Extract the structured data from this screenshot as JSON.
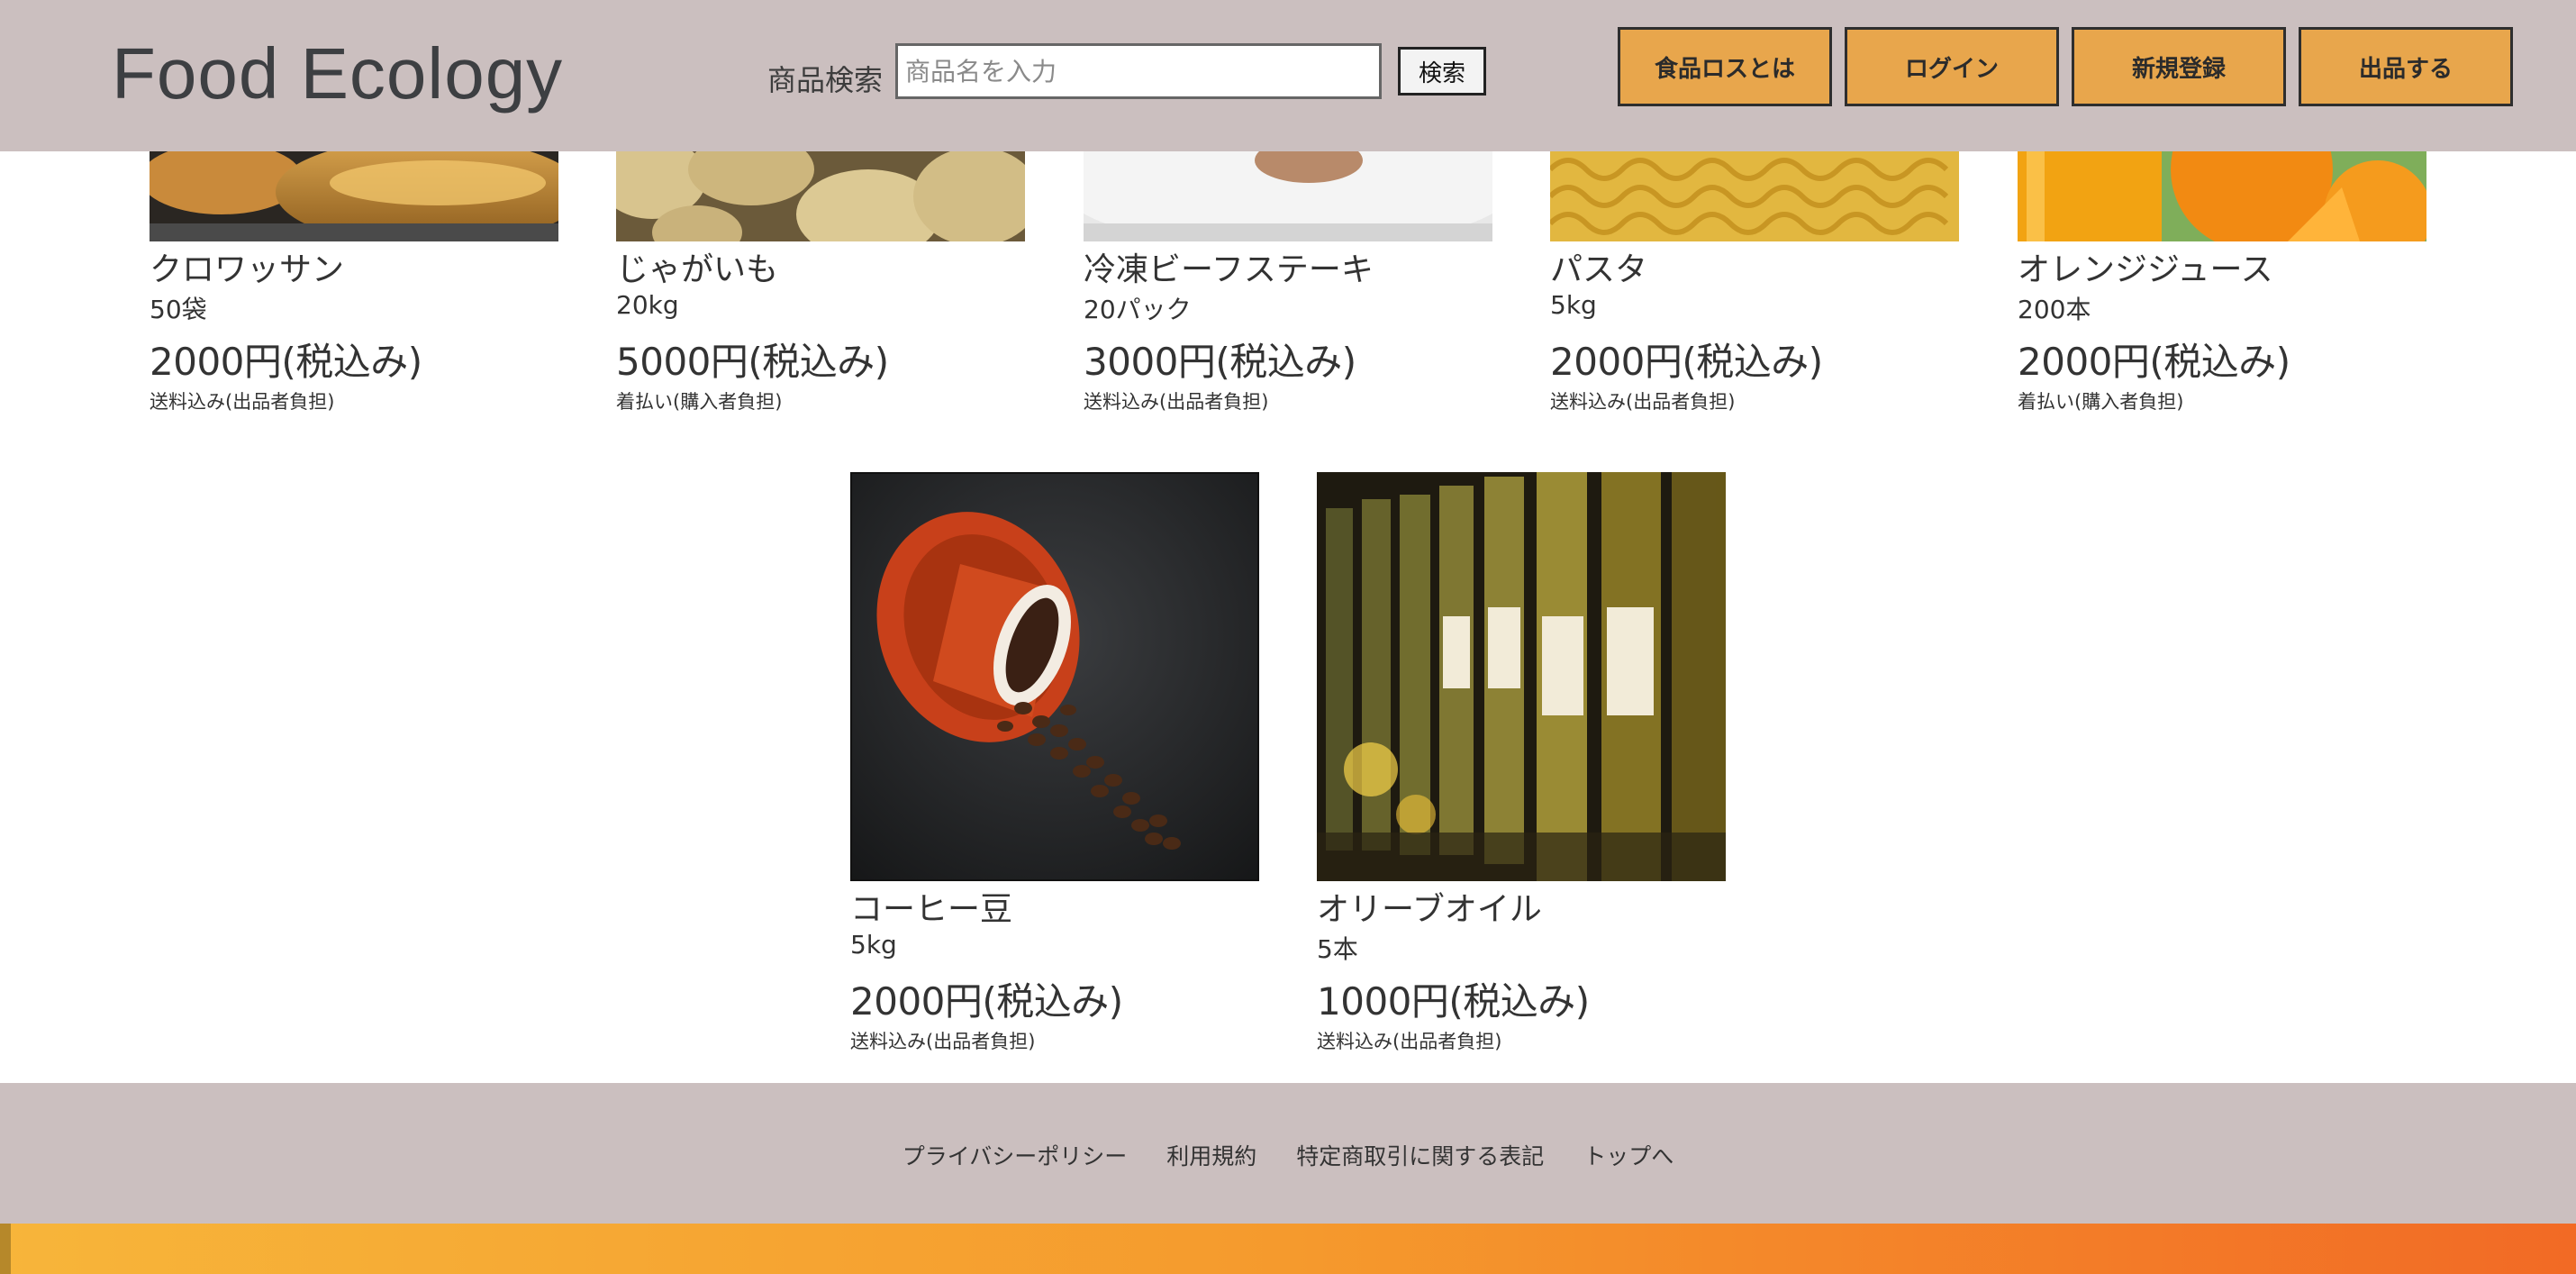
{
  "header": {
    "logo": "Food Ecology",
    "search_label": "商品検索",
    "search_placeholder": "商品名を入力",
    "search_button": "検索",
    "nav": [
      "食品ロスとは",
      "ログイン",
      "新規登録",
      "出品する"
    ],
    "nav_color": "#e8a64c",
    "bg_color": "#cbbfbf"
  },
  "products_row1": [
    {
      "name": "クロワッサン",
      "qty": "50袋",
      "price": "2000円(税込み)",
      "shipping": "送料込み(出品者負担)",
      "image": "croissant"
    },
    {
      "name": "じゃがいも",
      "qty": "20kg",
      "price": "5000円(税込み)",
      "shipping": "着払い(購入者負担)",
      "image": "potatoes"
    },
    {
      "name": "冷凍ビーフステーキ",
      "qty": "20パック",
      "price": "3000円(税込み)",
      "shipping": "送料込み(出品者負担)",
      "image": "steak-plate"
    },
    {
      "name": "パスタ",
      "qty": "5kg",
      "price": "2000円(税込み)",
      "shipping": "送料込み(出品者負担)",
      "image": "fusilli-pasta"
    },
    {
      "name": "オレンジジュース",
      "qty": "200本",
      "price": "2000円(税込み)",
      "shipping": "着払い(購入者負担)",
      "image": "orange-juice"
    }
  ],
  "products_row2": [
    {
      "name": "コーヒー豆",
      "qty": "5kg",
      "price": "2000円(税込み)",
      "shipping": "送料込み(出品者負担)",
      "image": "coffee-beans"
    },
    {
      "name": "オリーブオイル",
      "qty": "5本",
      "price": "1000円(税込み)",
      "shipping": "送料込み(出品者負担)",
      "image": "olive-oil-bottles"
    }
  ],
  "footer": {
    "links": [
      "プライバシーポリシー",
      "利用規約",
      "特定商取引に関する表記",
      "トップへ"
    ]
  }
}
